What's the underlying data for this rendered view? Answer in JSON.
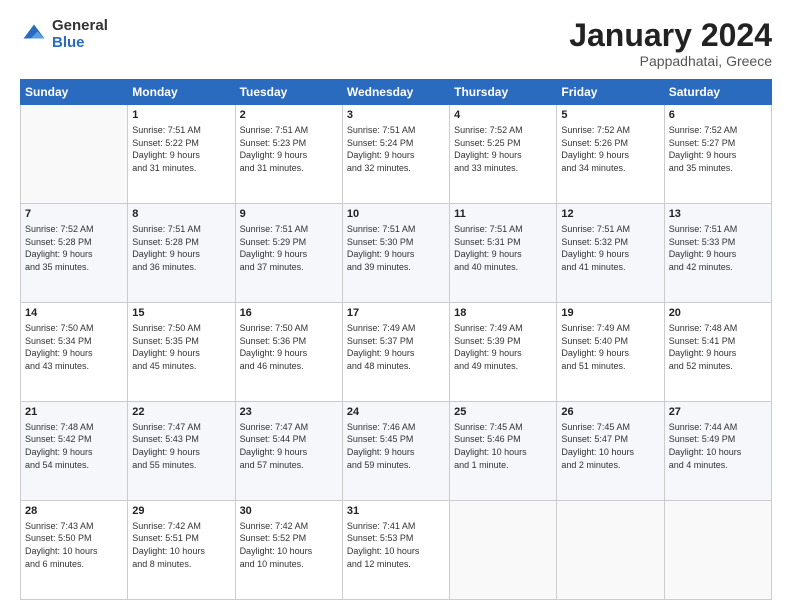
{
  "header": {
    "logo_general": "General",
    "logo_blue": "Blue",
    "month_title": "January 2024",
    "subtitle": "Pappadhatai, Greece"
  },
  "weekdays": [
    "Sunday",
    "Monday",
    "Tuesday",
    "Wednesday",
    "Thursday",
    "Friday",
    "Saturday"
  ],
  "weeks": [
    [
      {
        "day": "",
        "info": ""
      },
      {
        "day": "1",
        "info": "Sunrise: 7:51 AM\nSunset: 5:22 PM\nDaylight: 9 hours\nand 31 minutes."
      },
      {
        "day": "2",
        "info": "Sunrise: 7:51 AM\nSunset: 5:23 PM\nDaylight: 9 hours\nand 31 minutes."
      },
      {
        "day": "3",
        "info": "Sunrise: 7:51 AM\nSunset: 5:24 PM\nDaylight: 9 hours\nand 32 minutes."
      },
      {
        "day": "4",
        "info": "Sunrise: 7:52 AM\nSunset: 5:25 PM\nDaylight: 9 hours\nand 33 minutes."
      },
      {
        "day": "5",
        "info": "Sunrise: 7:52 AM\nSunset: 5:26 PM\nDaylight: 9 hours\nand 34 minutes."
      },
      {
        "day": "6",
        "info": "Sunrise: 7:52 AM\nSunset: 5:27 PM\nDaylight: 9 hours\nand 35 minutes."
      }
    ],
    [
      {
        "day": "7",
        "info": "Sunrise: 7:52 AM\nSunset: 5:28 PM\nDaylight: 9 hours\nand 35 minutes."
      },
      {
        "day": "8",
        "info": "Sunrise: 7:51 AM\nSunset: 5:28 PM\nDaylight: 9 hours\nand 36 minutes."
      },
      {
        "day": "9",
        "info": "Sunrise: 7:51 AM\nSunset: 5:29 PM\nDaylight: 9 hours\nand 37 minutes."
      },
      {
        "day": "10",
        "info": "Sunrise: 7:51 AM\nSunset: 5:30 PM\nDaylight: 9 hours\nand 39 minutes."
      },
      {
        "day": "11",
        "info": "Sunrise: 7:51 AM\nSunset: 5:31 PM\nDaylight: 9 hours\nand 40 minutes."
      },
      {
        "day": "12",
        "info": "Sunrise: 7:51 AM\nSunset: 5:32 PM\nDaylight: 9 hours\nand 41 minutes."
      },
      {
        "day": "13",
        "info": "Sunrise: 7:51 AM\nSunset: 5:33 PM\nDaylight: 9 hours\nand 42 minutes."
      }
    ],
    [
      {
        "day": "14",
        "info": "Sunrise: 7:50 AM\nSunset: 5:34 PM\nDaylight: 9 hours\nand 43 minutes."
      },
      {
        "day": "15",
        "info": "Sunrise: 7:50 AM\nSunset: 5:35 PM\nDaylight: 9 hours\nand 45 minutes."
      },
      {
        "day": "16",
        "info": "Sunrise: 7:50 AM\nSunset: 5:36 PM\nDaylight: 9 hours\nand 46 minutes."
      },
      {
        "day": "17",
        "info": "Sunrise: 7:49 AM\nSunset: 5:37 PM\nDaylight: 9 hours\nand 48 minutes."
      },
      {
        "day": "18",
        "info": "Sunrise: 7:49 AM\nSunset: 5:39 PM\nDaylight: 9 hours\nand 49 minutes."
      },
      {
        "day": "19",
        "info": "Sunrise: 7:49 AM\nSunset: 5:40 PM\nDaylight: 9 hours\nand 51 minutes."
      },
      {
        "day": "20",
        "info": "Sunrise: 7:48 AM\nSunset: 5:41 PM\nDaylight: 9 hours\nand 52 minutes."
      }
    ],
    [
      {
        "day": "21",
        "info": "Sunrise: 7:48 AM\nSunset: 5:42 PM\nDaylight: 9 hours\nand 54 minutes."
      },
      {
        "day": "22",
        "info": "Sunrise: 7:47 AM\nSunset: 5:43 PM\nDaylight: 9 hours\nand 55 minutes."
      },
      {
        "day": "23",
        "info": "Sunrise: 7:47 AM\nSunset: 5:44 PM\nDaylight: 9 hours\nand 57 minutes."
      },
      {
        "day": "24",
        "info": "Sunrise: 7:46 AM\nSunset: 5:45 PM\nDaylight: 9 hours\nand 59 minutes."
      },
      {
        "day": "25",
        "info": "Sunrise: 7:45 AM\nSunset: 5:46 PM\nDaylight: 10 hours\nand 1 minute."
      },
      {
        "day": "26",
        "info": "Sunrise: 7:45 AM\nSunset: 5:47 PM\nDaylight: 10 hours\nand 2 minutes."
      },
      {
        "day": "27",
        "info": "Sunrise: 7:44 AM\nSunset: 5:49 PM\nDaylight: 10 hours\nand 4 minutes."
      }
    ],
    [
      {
        "day": "28",
        "info": "Sunrise: 7:43 AM\nSunset: 5:50 PM\nDaylight: 10 hours\nand 6 minutes."
      },
      {
        "day": "29",
        "info": "Sunrise: 7:42 AM\nSunset: 5:51 PM\nDaylight: 10 hours\nand 8 minutes."
      },
      {
        "day": "30",
        "info": "Sunrise: 7:42 AM\nSunset: 5:52 PM\nDaylight: 10 hours\nand 10 minutes."
      },
      {
        "day": "31",
        "info": "Sunrise: 7:41 AM\nSunset: 5:53 PM\nDaylight: 10 hours\nand 12 minutes."
      },
      {
        "day": "",
        "info": ""
      },
      {
        "day": "",
        "info": ""
      },
      {
        "day": "",
        "info": ""
      }
    ]
  ]
}
